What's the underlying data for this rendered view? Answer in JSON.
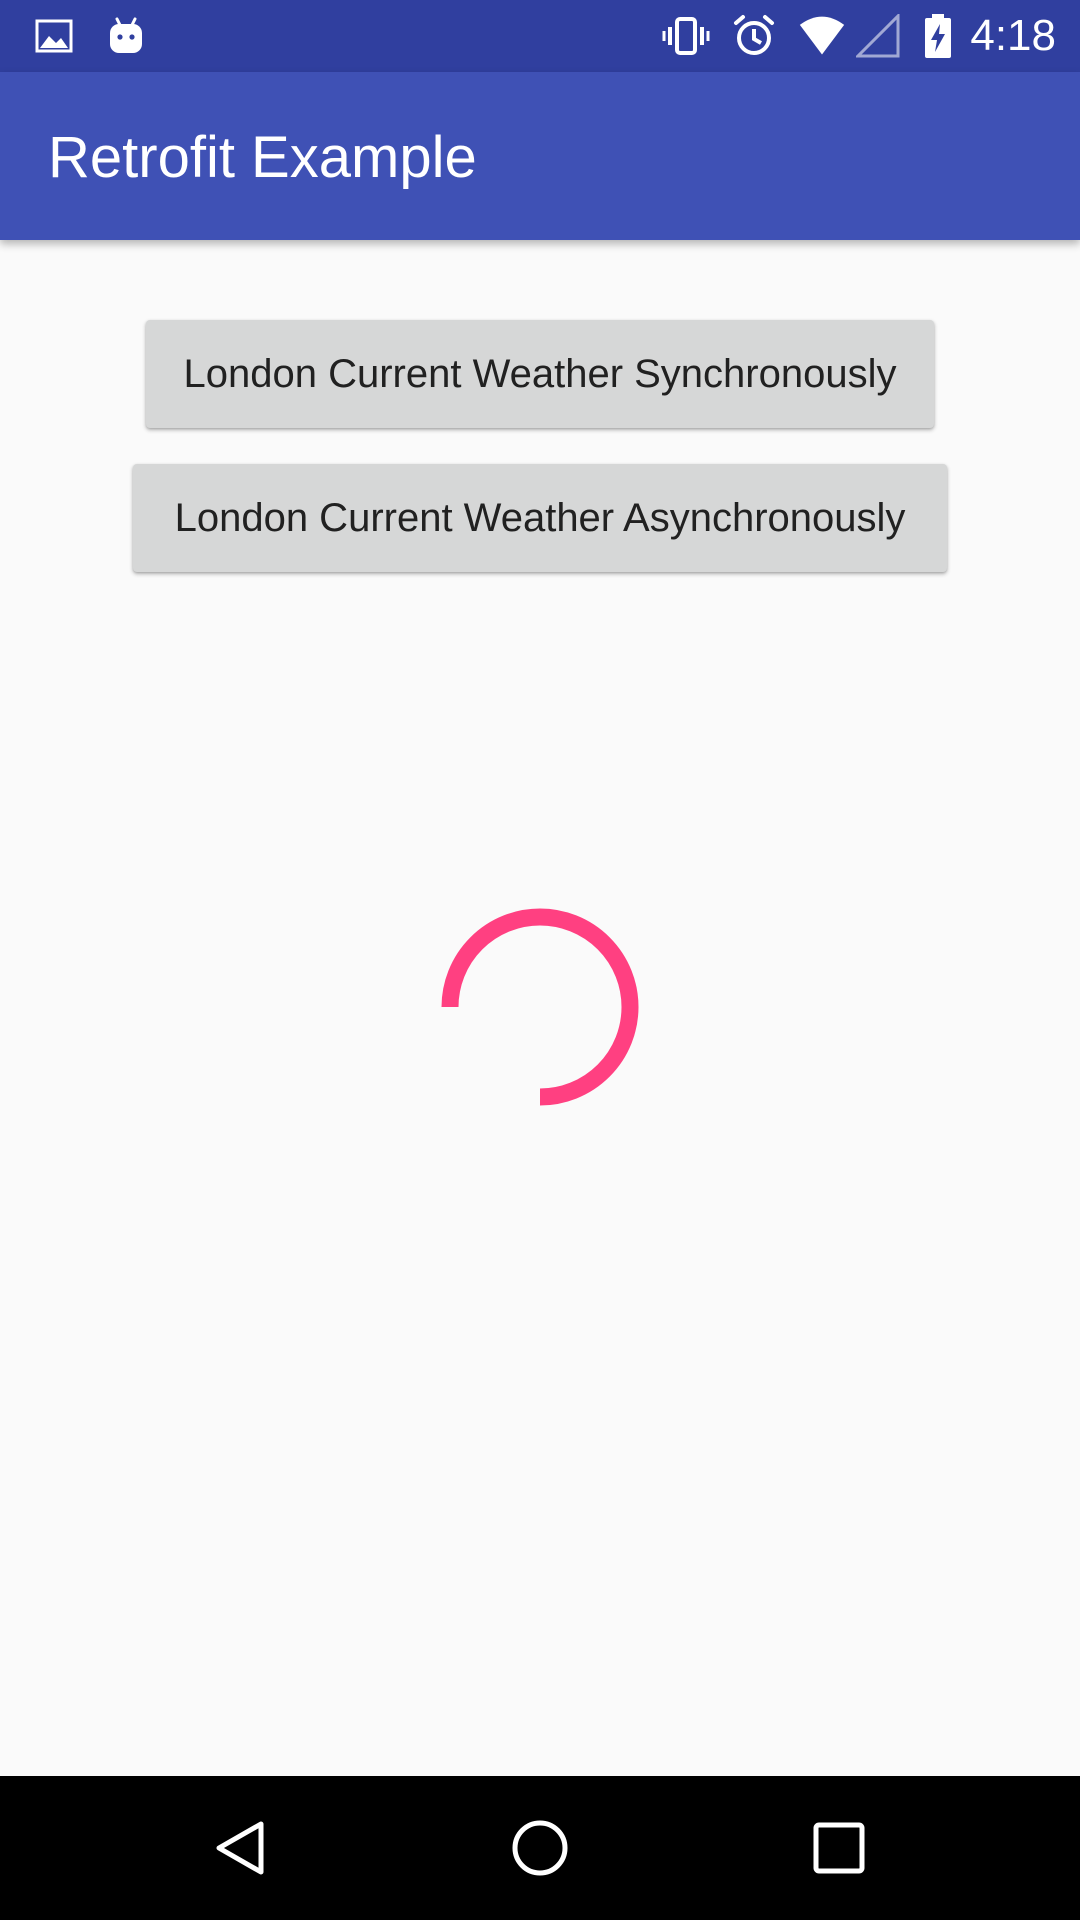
{
  "status_bar": {
    "time": "4:18",
    "background_color": "#303f9f",
    "left_icons": [
      "image-notification-icon",
      "android-notification-icon"
    ],
    "right_icons": [
      "vibrate-icon",
      "alarm-icon",
      "wifi-icon",
      "cellular-signal-icon",
      "battery-charging-icon"
    ]
  },
  "app_bar": {
    "title": "Retrofit Example",
    "background_color": "#3f51b5"
  },
  "main": {
    "buttons": [
      {
        "label": "London Current Weather Synchronously"
      },
      {
        "label": "London Current Weather Asynchronously"
      }
    ],
    "progress": {
      "type": "indeterminate-circular-spinner",
      "color": "#ff4081"
    }
  },
  "nav_bar": {
    "icons": [
      "back-icon",
      "home-icon",
      "recents-icon"
    ]
  }
}
